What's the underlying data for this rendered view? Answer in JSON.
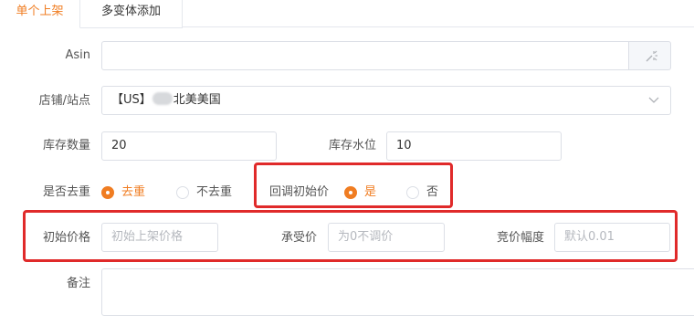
{
  "tabs": [
    {
      "label": "单个上架",
      "active": true
    },
    {
      "label": "多变体添加",
      "active": false
    }
  ],
  "form": {
    "asin": {
      "label": "Asin",
      "value": "",
      "button_icon": "magic-wand-icon"
    },
    "store": {
      "label": "店铺/站点",
      "prefix": "【US】",
      "suffix": "北美美国",
      "chevron_icon": "chevron-down-icon"
    },
    "stock_qty": {
      "label": "库存数量",
      "value": "20"
    },
    "stock_level": {
      "label": "库存水位",
      "value": "10"
    },
    "dedupe": {
      "label": "是否去重",
      "options": [
        "去重",
        "不去重"
      ],
      "selected": "去重"
    },
    "callback_price": {
      "label": "回调初始价",
      "options": [
        "是",
        "否"
      ],
      "selected": "是"
    },
    "initial_price": {
      "label": "初始价格",
      "placeholder": "初始上架价格"
    },
    "accept_price": {
      "label": "承受价",
      "placeholder": "为0不调价"
    },
    "bid_range": {
      "label": "竞价幅度",
      "placeholder": "默认0.01"
    },
    "remark": {
      "label": "备注",
      "value": ""
    }
  },
  "colors": {
    "accent": "#f07d22",
    "highlight": "#e02a2a",
    "border": "#dcdfe6"
  }
}
